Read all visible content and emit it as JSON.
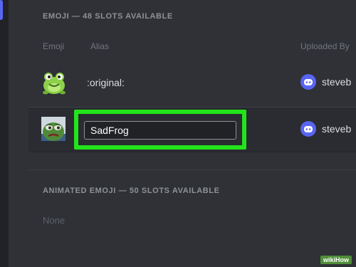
{
  "sections": {
    "emoji_title": "EMOJI — 48 SLOTS AVAILABLE",
    "animated_title": "ANIMATED EMOJI — 50 SLOTS AVAILABLE",
    "animated_empty": "None"
  },
  "columns": {
    "emoji": "Emoji",
    "alias": "Alias",
    "uploaded_by": "Uploaded By"
  },
  "rows": [
    {
      "alias": ":original:",
      "uploader": "steveb",
      "icon": "frog-icon"
    },
    {
      "alias_value": "SadFrog",
      "uploader": "steveb",
      "icon": "sad-frog-icon"
    }
  ],
  "colors": {
    "background": "#2f3136",
    "highlight": "#22e41b",
    "avatar": "#5865f2"
  },
  "watermark": "wikiHow"
}
